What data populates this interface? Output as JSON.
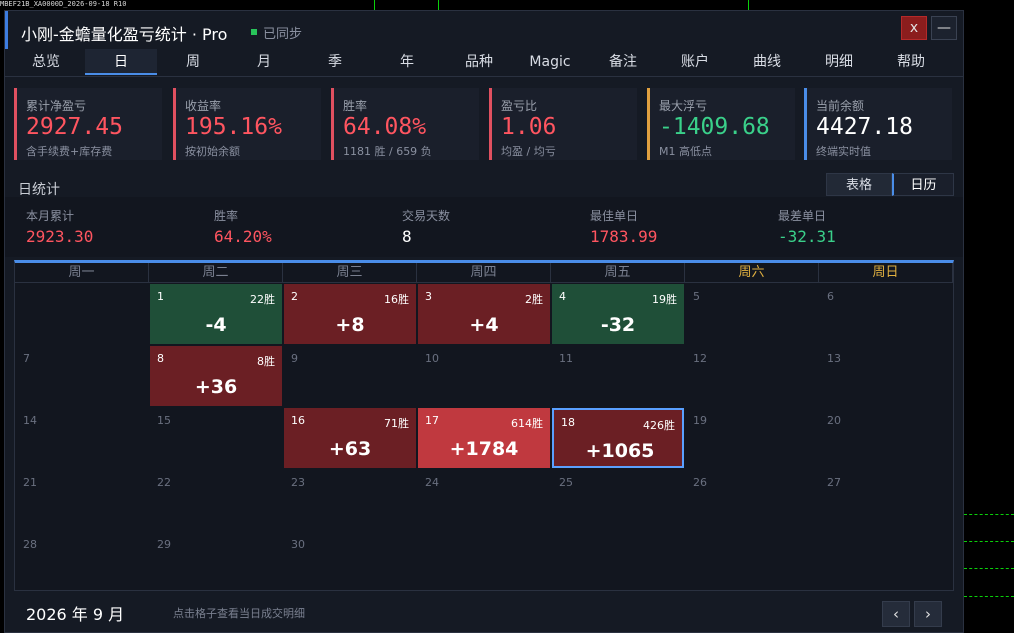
{
  "background": {
    "label": "MBEF21B_XA0000D_2026-09-18 R10"
  },
  "window": {
    "title": "小刚-金蟾量化盈亏统计 · Pro",
    "sync_status": "已同步",
    "close_label": "x",
    "minimize_label": "—",
    "accent": "#3d7de0"
  },
  "tabs": [
    {
      "label": "总览"
    },
    {
      "label": "日"
    },
    {
      "label": "周"
    },
    {
      "label": "月"
    },
    {
      "label": "季"
    },
    {
      "label": "年"
    },
    {
      "label": "品种"
    },
    {
      "label": "Magic"
    },
    {
      "label": "备注"
    },
    {
      "label": "账户"
    },
    {
      "label": "曲线"
    },
    {
      "label": "明细"
    },
    {
      "label": "帮助"
    }
  ],
  "active_tab": "日",
  "cards": [
    {
      "label": "累计净盈亏",
      "value": "2927.45",
      "sub": "含手续费+库存费",
      "color": "#ff5560"
    },
    {
      "label": "收益率",
      "value": "195.16%",
      "sub": "按初始余额",
      "color": "#ff5560"
    },
    {
      "label": "胜率",
      "value": "64.08%",
      "sub": "1181 胜 / 659 负",
      "color": "#ff5560"
    },
    {
      "label": "盈亏比",
      "value": "1.06",
      "sub": "均盈 / 均亏",
      "color": "#ff5560"
    },
    {
      "label": "最大浮亏",
      "value": "-1409.68",
      "sub": "M1 高低点",
      "color": "#3ad08a"
    },
    {
      "label": "当前余额",
      "value": "4427.18",
      "sub": "终端实时值",
      "color": "#ffffff"
    }
  ],
  "section": {
    "title": "日统计",
    "view_table": "表格",
    "view_calendar": "日历"
  },
  "summary": [
    {
      "label": "本月累计",
      "value": "2923.30",
      "color": "#ff5560"
    },
    {
      "label": "胜率",
      "value": "64.20%",
      "color": "#ff5560"
    },
    {
      "label": "交易天数",
      "value": "8",
      "color": "#ffffff"
    },
    {
      "label": "最佳单日",
      "value": "1783.99",
      "color": "#ff5560"
    },
    {
      "label": "最差单日",
      "value": "-32.31",
      "color": "#3ad08a"
    }
  ],
  "weekdays": [
    "周一",
    "周二",
    "周三",
    "周四",
    "周五",
    "周六",
    "周日"
  ],
  "calendar": {
    "weeks": [
      [
        null,
        {
          "day": "1",
          "wins": "22胜",
          "pnl": "-4",
          "kind": "neg"
        },
        {
          "day": "2",
          "wins": "16胜",
          "pnl": "+8",
          "kind": "pos"
        },
        {
          "day": "3",
          "wins": "2胜",
          "pnl": "+4",
          "kind": "pos"
        },
        {
          "day": "4",
          "wins": "19胜",
          "pnl": "-32",
          "kind": "neg"
        },
        {
          "day": "5"
        },
        {
          "day": "6"
        }
      ],
      [
        {
          "day": "7"
        },
        {
          "day": "8",
          "wins": "8胜",
          "pnl": "+36",
          "kind": "pos"
        },
        {
          "day": "9"
        },
        {
          "day": "10"
        },
        {
          "day": "11"
        },
        {
          "day": "12"
        },
        {
          "day": "13"
        }
      ],
      [
        {
          "day": "14"
        },
        {
          "day": "15"
        },
        {
          "day": "16",
          "wins": "71胜",
          "pnl": "+63",
          "kind": "pos"
        },
        {
          "day": "17",
          "wins": "614胜",
          "pnl": "+1784",
          "kind": "hot"
        },
        {
          "day": "18",
          "wins": "426胜",
          "pnl": "+1065",
          "kind": "pos",
          "selected": true
        },
        {
          "day": "19"
        },
        {
          "day": "20"
        }
      ],
      [
        {
          "day": "21"
        },
        {
          "day": "22"
        },
        {
          "day": "23"
        },
        {
          "day": "24"
        },
        {
          "day": "25"
        },
        {
          "day": "26"
        },
        {
          "day": "27"
        }
      ],
      [
        {
          "day": "28"
        },
        {
          "day": "29"
        },
        {
          "day": "30"
        },
        null,
        null,
        null,
        null
      ]
    ]
  },
  "footer": {
    "month": "2026 年 9 月",
    "hint": "点击格子查看当日成交明细",
    "prev_label": "‹",
    "next_label": "›"
  }
}
